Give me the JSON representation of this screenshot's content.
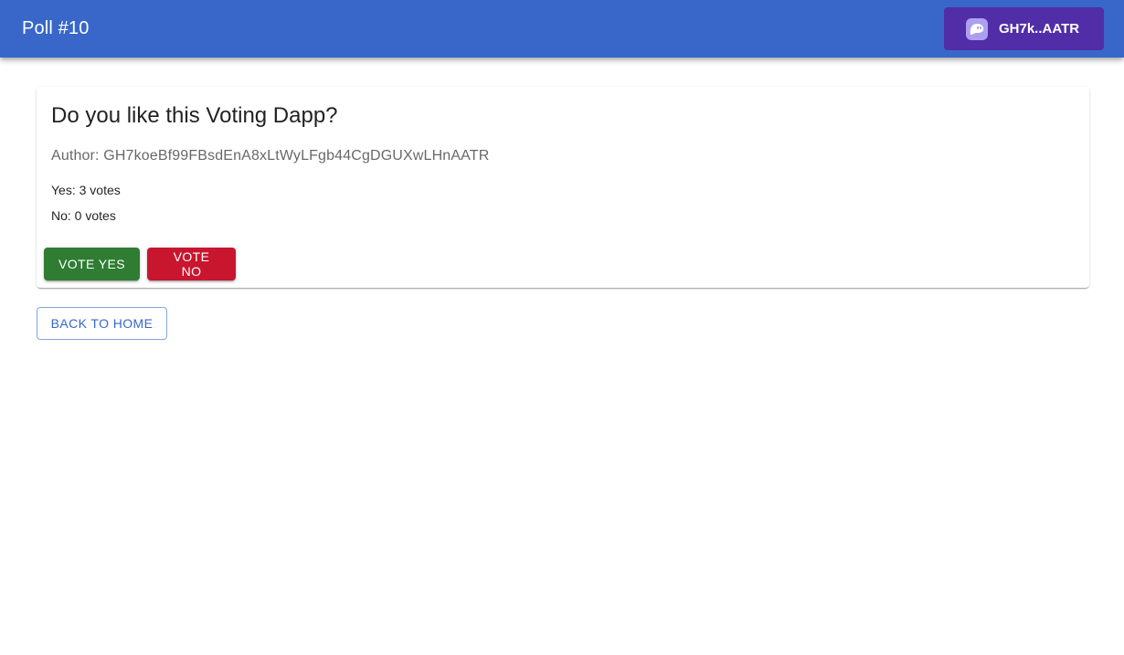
{
  "header": {
    "title": "Poll #10",
    "wallet_label": "GH7k..AATR",
    "wallet_icon": "phantom-ghost-icon"
  },
  "poll": {
    "question": "Do you like this Voting Dapp?",
    "author": "Author: GH7koeBf99FBsdEnA8xLtWyLFgb44CgDGUXwLHnAATR",
    "yes_votes": "Yes: 3 votes",
    "no_votes": "No: 0 votes",
    "vote_yes_label": "VOTE YES",
    "vote_no_label": "VOTE NO"
  },
  "navigation": {
    "back_label": "BACK TO HOME"
  },
  "colors": {
    "app_bar": "#3867c9",
    "wallet_button": "#512da8",
    "vote_yes": "#2e7d32",
    "vote_no": "#c8162e"
  }
}
